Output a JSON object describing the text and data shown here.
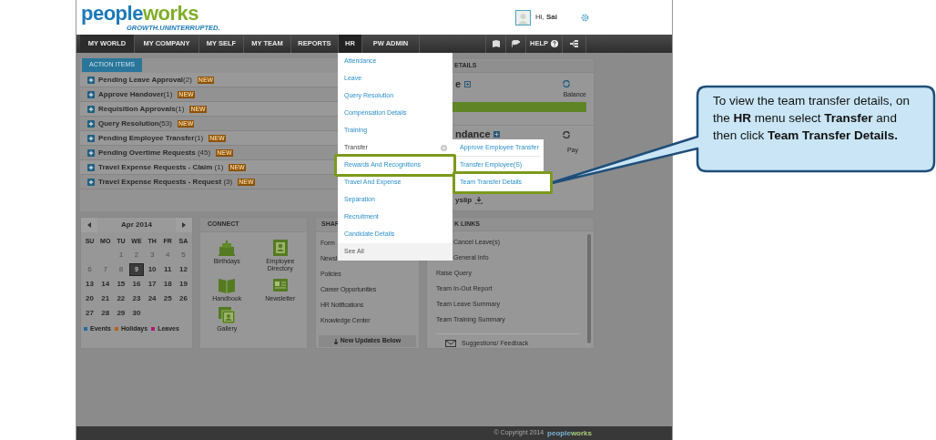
{
  "header": {
    "logo": {
      "parts": [
        "people",
        "works"
      ],
      "tagline": "GROWTH.UNINTERRUPTED."
    },
    "greeting": "Hi, **Sai**"
  },
  "nav": {
    "items": [
      {
        "label": "MY WORLD",
        "selected": true,
        "open": false
      },
      {
        "label": "MY COMPANY",
        "selected": false,
        "open": false
      },
      {
        "label": "MY SELF",
        "selected": false,
        "open": false
      },
      {
        "label": "MY TEAM",
        "selected": false,
        "open": false
      },
      {
        "label": "REPORTS",
        "selected": false,
        "open": false
      },
      {
        "label": "HR",
        "selected": false,
        "open": true
      },
      {
        "label": "PW ADMIN",
        "selected": false,
        "open": false
      }
    ],
    "help": "HELP"
  },
  "action_items": {
    "tab": "ACTION ITEMS",
    "rows": [
      {
        "text": "**Pending Leave Approval**(2)",
        "badge": "NEW"
      },
      {
        "text": "**Approve Handover**(1)",
        "badge": "NEW"
      },
      {
        "text": "**Requisition Approvals**(1)",
        "badge": "NEW"
      },
      {
        "text": "**Query Resolution**(53)",
        "badge": "NEW"
      },
      {
        "text": "**Pending Employee Transfer**(1)",
        "badge": "NEW"
      },
      {
        "text": "**Pending Overtime Requests** (45)",
        "badge": "NEW"
      },
      {
        "text": "**Travel Expense Requests - Claim** (1)",
        "badge": "NEW"
      },
      {
        "text": "**Travel Expense Requests - Request** (3)",
        "badge": "NEW"
      }
    ]
  },
  "details": {
    "header": "ETAILS",
    "leave_title": "e",
    "balance_label": "Balance",
    "attendance_title": "ndance",
    "pay_label": "Pay",
    "payslip": "yslip"
  },
  "calendar": {
    "month": "Apr 2014",
    "weekdays": [
      "SU",
      "MO",
      "TU",
      "WE",
      "TH",
      "FR",
      "SA"
    ],
    "weeks": [
      [
        {
          "day": "1",
          "muted": true,
          "selected": false
        },
        {
          "day": "2",
          "muted": true,
          "selected": false
        },
        {
          "day": "3",
          "muted": true,
          "selected": false
        },
        {
          "day": "4",
          "muted": true,
          "selected": false
        },
        {
          "day": "5",
          "muted": true,
          "selected": false
        }
      ],
      [
        {
          "day": "6",
          "muted": true,
          "selected": false
        },
        {
          "day": "7",
          "muted": true,
          "selected": false
        },
        {
          "day": "8",
          "muted": true,
          "selected": false
        },
        {
          "day": "9",
          "muted": false,
          "selected": true
        },
        {
          "day": "10",
          "muted": false,
          "selected": false
        },
        {
          "day": "11",
          "muted": false,
          "selected": false
        },
        {
          "day": "12",
          "muted": false,
          "selected": false
        }
      ],
      [
        {
          "day": "13",
          "muted": false,
          "selected": false
        },
        {
          "day": "14",
          "muted": false,
          "selected": false
        },
        {
          "day": "15",
          "muted": false,
          "selected": false
        },
        {
          "day": "16",
          "muted": false,
          "selected": false
        },
        {
          "day": "17",
          "muted": false,
          "selected": false
        },
        {
          "day": "18",
          "muted": false,
          "selected": false
        },
        {
          "day": "19",
          "muted": false,
          "selected": false
        }
      ],
      [
        {
          "day": "20",
          "muted": false,
          "selected": false
        },
        {
          "day": "21",
          "muted": false,
          "selected": false
        },
        {
          "day": "22",
          "muted": false,
          "selected": false
        },
        {
          "day": "23",
          "muted": false,
          "selected": false
        },
        {
          "day": "24",
          "muted": false,
          "selected": false
        },
        {
          "day": "25",
          "muted": false,
          "selected": false
        },
        {
          "day": "26",
          "muted": false,
          "selected": false
        }
      ],
      [
        {
          "day": "27",
          "muted": false,
          "selected": false
        },
        {
          "day": "28",
          "muted": false,
          "selected": false
        },
        {
          "day": "29",
          "muted": false,
          "selected": false
        },
        {
          "day": "30",
          "muted": false,
          "selected": false
        }
      ]
    ],
    "legend": [
      {
        "label": "Events",
        "color": "#1f6fa8"
      },
      {
        "label": "Holidays",
        "color": "#b8621b"
      },
      {
        "label": "Leaves",
        "color": "#b0187a"
      }
    ]
  },
  "connect": {
    "title": "CONNECT",
    "items": [
      {
        "label": "Birthdays",
        "kind": "cake"
      },
      {
        "label": "Employee Directory",
        "kind": "directory"
      },
      {
        "label": "Handbook",
        "kind": "book"
      },
      {
        "label": "Newsletter",
        "kind": "newsletter"
      },
      {
        "label": "Gallery",
        "kind": "gallery"
      }
    ]
  },
  "shared": {
    "title": "SHAR",
    "links": [
      "Form",
      "Newsl",
      "Policies",
      "Career Opportunities",
      "HR Notifications",
      "Knowledge Center"
    ],
    "footer": "New Updates Below"
  },
  "quick_links": {
    "title": "K LINKS",
    "links": [
      "Cancel Leave(s)",
      "General Info",
      "Raise Query",
      "Team In-Out Report",
      "Team Leave Summary",
      "Team Training Summary"
    ],
    "feedback": "Suggestions/ Feedback"
  },
  "hr_menu": {
    "items": [
      {
        "label": "Attendance",
        "kind": "link",
        "highlighted": false
      },
      {
        "label": "Leave",
        "kind": "link",
        "highlighted": false
      },
      {
        "label": "Query Resolution",
        "kind": "link",
        "highlighted": false
      },
      {
        "label": "Compensation Details",
        "kind": "link",
        "highlighted": false
      },
      {
        "label": "Training",
        "kind": "link",
        "highlighted": false
      },
      {
        "label": "Transfer",
        "kind": "submenu",
        "highlighted": false
      },
      {
        "label": "Rewards And Recognitions",
        "kind": "link",
        "highlighted": true
      },
      {
        "label": "Travel And Expense",
        "kind": "link",
        "highlighted": false
      },
      {
        "label": "Separation",
        "kind": "link",
        "highlighted": false
      },
      {
        "label": "Recruitment",
        "kind": "link",
        "highlighted": false
      },
      {
        "label": "Candidate Details",
        "kind": "link",
        "highlighted": false
      },
      {
        "label": "See All",
        "kind": "footer",
        "highlighted": false
      }
    ]
  },
  "submenu": {
    "items": [
      {
        "label": "Approve Employee Transfer",
        "highlighted": false
      },
      {
        "label": "Transfer Employee(S)",
        "highlighted": false
      },
      {
        "label": "Team Transfer Details",
        "highlighted": true
      }
    ]
  },
  "footer": {
    "copyright": "© Copyright 2014",
    "logo": [
      "people",
      "works"
    ]
  },
  "callout": {
    "text": "To view the team transfer details, on the **HR** menu select **Transfer** and then click **Team Transfer Details.**"
  }
}
